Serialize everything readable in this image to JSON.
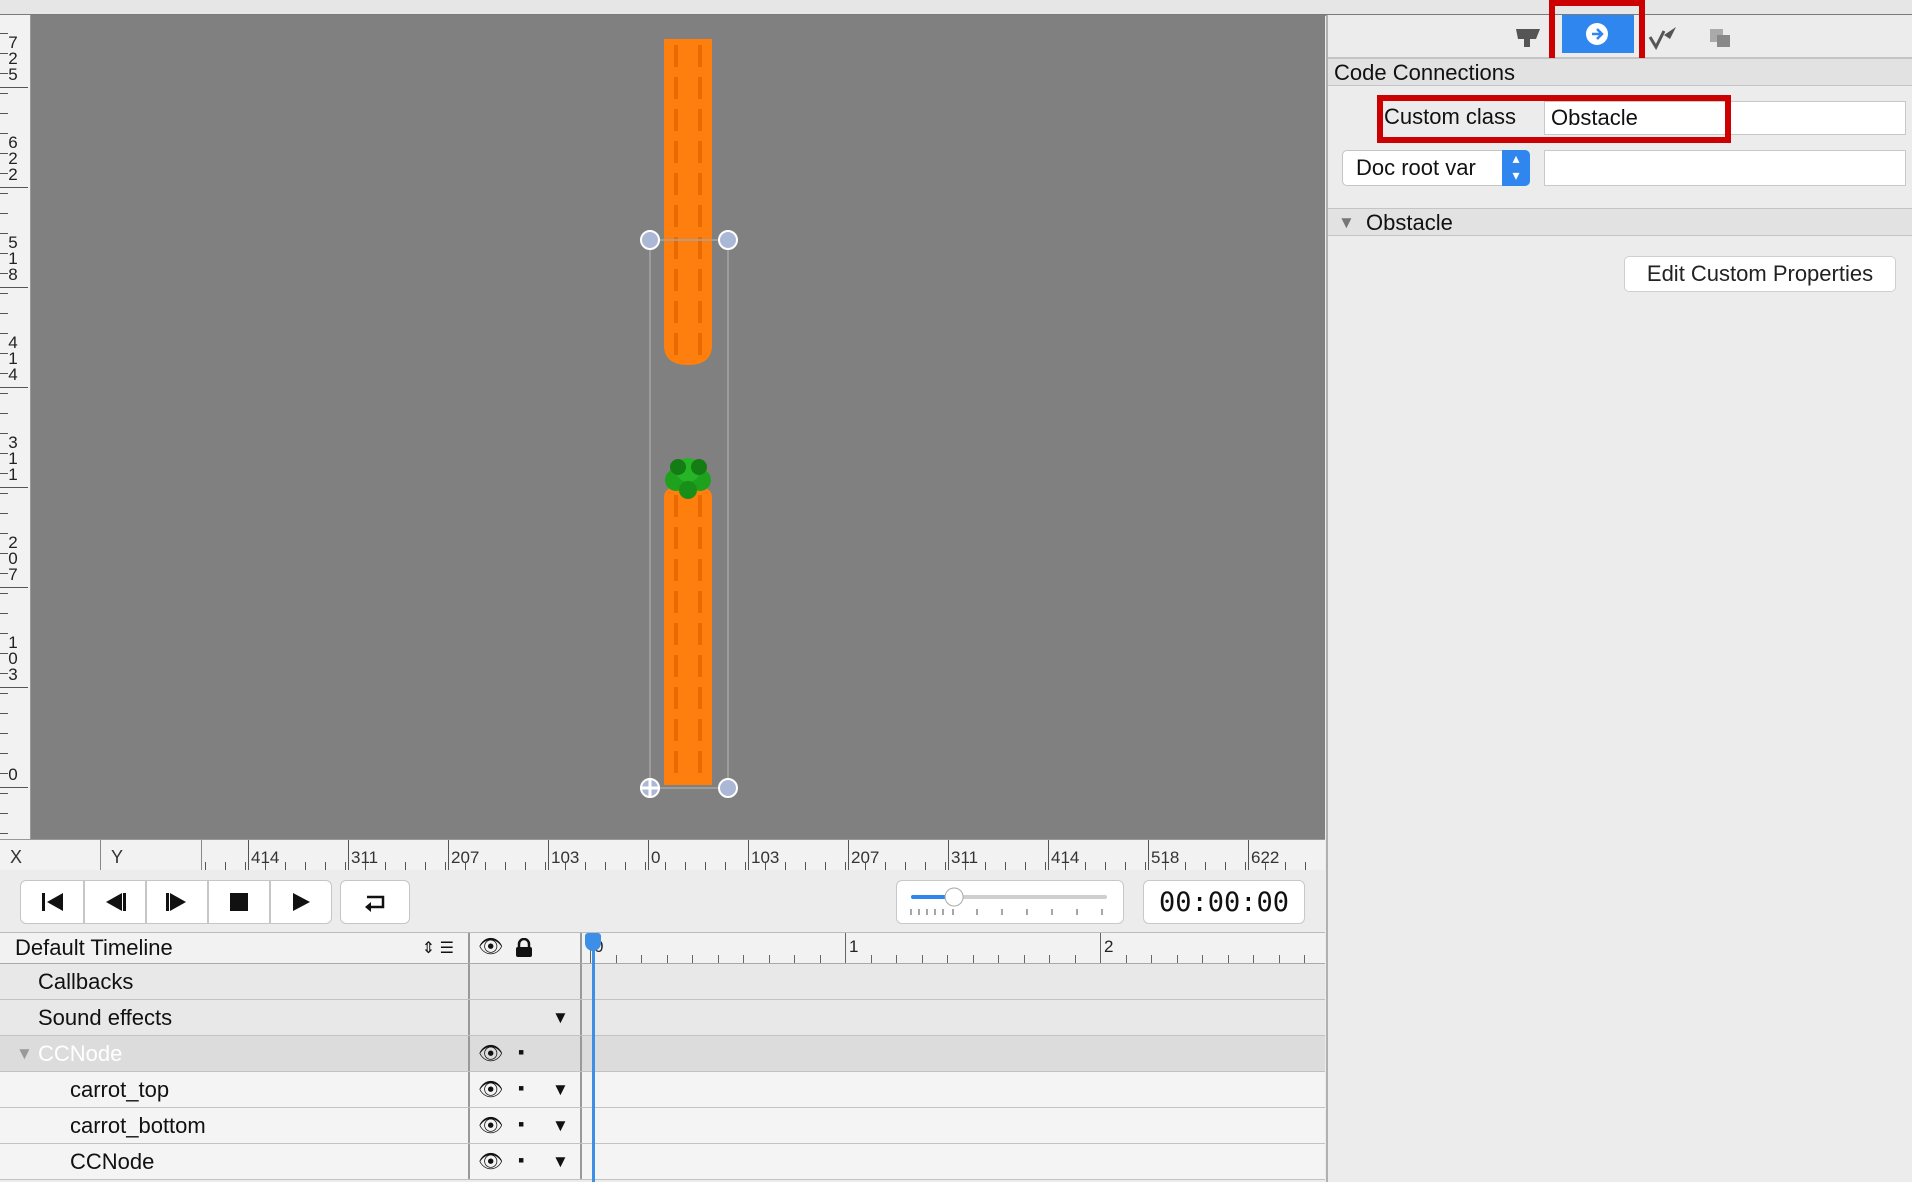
{
  "canvas": {
    "vertical_ruler_labels": [
      "725",
      "622",
      "518",
      "414",
      "311",
      "207",
      "103",
      "0"
    ],
    "horizontal_ruler": {
      "x_label": "X",
      "y_label": "Y",
      "labels": [
        "414",
        "311",
        "207",
        "103",
        "0",
        "103",
        "207",
        "311",
        "414",
        "518",
        "622"
      ]
    },
    "background_color": "#808080",
    "carrot_color": "#ff7f0e",
    "leaf_color": "#1ea21e"
  },
  "playback": {
    "buttons": [
      "skip-to-start-icon",
      "step-back-icon",
      "step-forward-icon",
      "stop-icon",
      "play-icon",
      "loop-icon"
    ],
    "time": "00:00:00",
    "timeline_scale_fraction": 0.22
  },
  "timeline": {
    "name": "Default Timeline",
    "ruler_labels": [
      "0",
      "1",
      "2"
    ],
    "rows": [
      {
        "label": "Callbacks"
      },
      {
        "label": "Sound effects"
      },
      {
        "label": "CCNode"
      },
      {
        "label": "carrot_top"
      },
      {
        "label": "carrot_bottom"
      },
      {
        "label": "CCNode"
      }
    ]
  },
  "inspector": {
    "tabs": [
      "node-properties-icon",
      "code-connections-icon",
      "physics-icon",
      "templates-icon"
    ],
    "active_tab": "code-connections-icon",
    "code_connections_title": "Code Connections",
    "custom_class_label": "Custom class",
    "custom_class_value": "Obstacle",
    "doc_root_var_label": "Doc root var",
    "doc_root_var_value": "",
    "obstacle_section_title": "Obstacle",
    "edit_custom_properties_label": "Edit Custom Properties",
    "highlight_color": "#cc0000",
    "accent_color": "#2f86ee"
  }
}
